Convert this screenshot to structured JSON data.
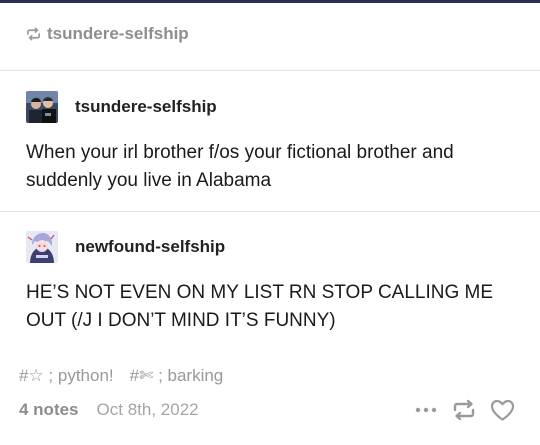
{
  "reblog": {
    "icon": "reblog-icon",
    "label": "tsundere-selfship"
  },
  "posts": [
    {
      "username": "tsundere-selfship",
      "avatar": "avatar-photo",
      "text": "When your irl brother f/os your fictional brother and suddenly you live in Alabama"
    },
    {
      "username": "newfound-selfship",
      "avatar": "avatar-anime",
      "text": "HE’S NOT EVEN ON MY LIST RN STOP CALLING ME OUT (/J I DON’T MIND IT’S FUNNY)"
    }
  ],
  "tags": [
    "#☆ ; python!",
    "#✄ ; barking"
  ],
  "footer": {
    "notes": "4 notes",
    "date": "Oct 8th, 2022",
    "icons": [
      "more-icon",
      "reblog-icon",
      "like-icon"
    ]
  },
  "colors": {
    "top_bar": "#2b2d52",
    "muted": "#8e8e8e",
    "text": "#1a1a1a"
  }
}
